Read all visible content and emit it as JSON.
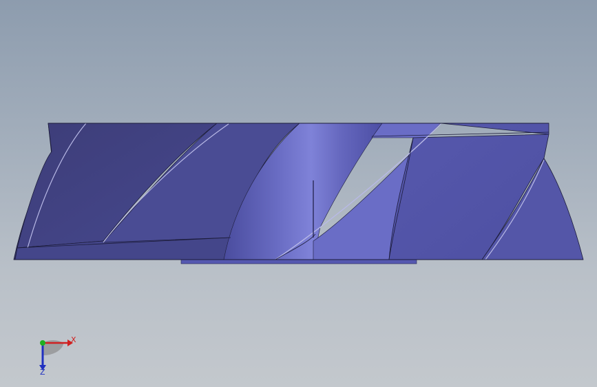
{
  "viewport": {
    "background_top": "#8d9cae",
    "background_bottom": "#c3c8cd"
  },
  "model": {
    "name": "helical-impeller",
    "view": "front",
    "colors": {
      "dark_face": "#3f3f7a",
      "mid_face": "#5153a5",
      "light_face": "#7679cf",
      "edge": "#1c1c3a",
      "highlight_edge": "#c8c8ee"
    }
  },
  "triad": {
    "x_label": "X",
    "z_label": "Z",
    "x_color": "#d02020",
    "y_color": "#20b020",
    "z_color": "#2030c0"
  }
}
